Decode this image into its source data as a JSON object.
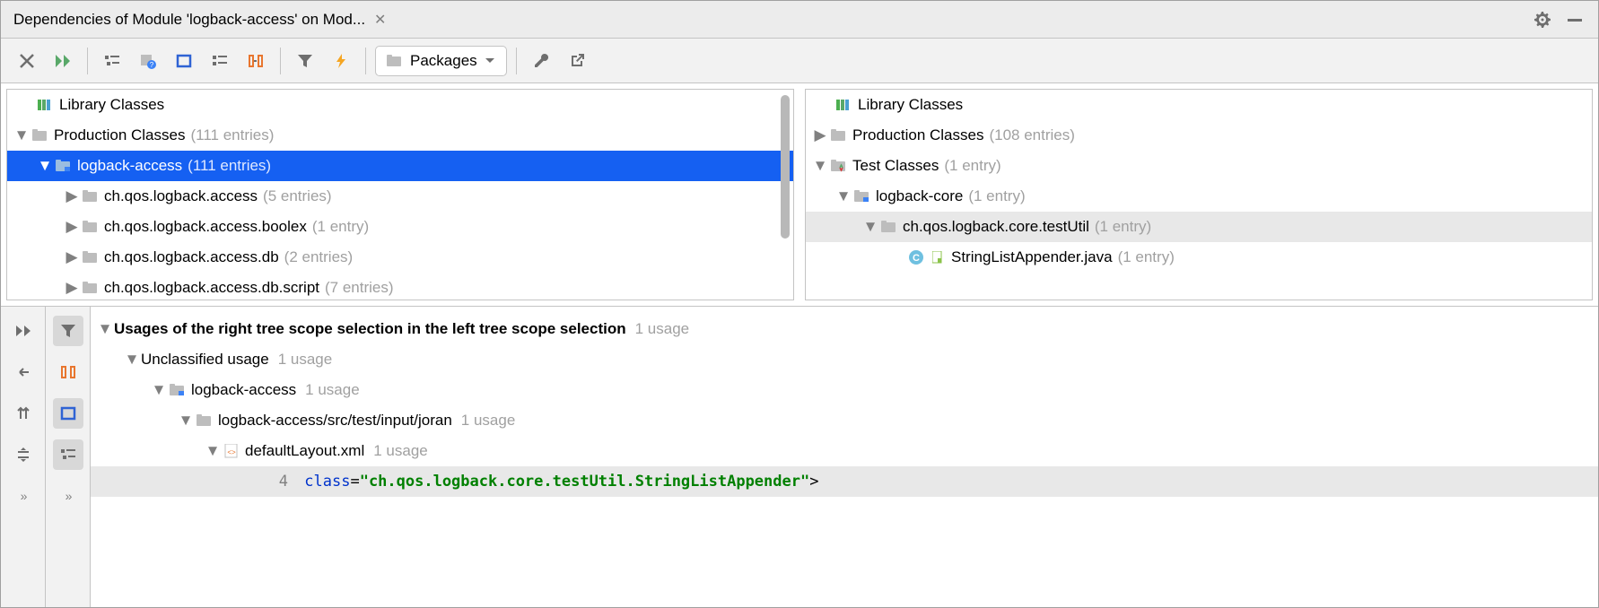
{
  "tab": {
    "title": "Dependencies of Module 'logback-access' on Mod..."
  },
  "toolbar": {
    "packages_label": "Packages"
  },
  "left_tree": {
    "library_label": "Library Classes",
    "prod_label": "Production Classes",
    "prod_count": "(111 entries)",
    "module_label": "logback-access",
    "module_count": "(111 entries)",
    "packages": [
      {
        "name": "ch.qos.logback.access",
        "count": "(5 entries)"
      },
      {
        "name": "ch.qos.logback.access.boolex",
        "count": "(1 entry)"
      },
      {
        "name": "ch.qos.logback.access.db",
        "count": "(2 entries)"
      },
      {
        "name": "ch.qos.logback.access.db.script",
        "count": "(7 entries)"
      }
    ]
  },
  "right_tree": {
    "library_label": "Library Classes",
    "prod_label": "Production Classes",
    "prod_count": "(108 entries)",
    "test_label": "Test Classes",
    "test_count": "(1 entry)",
    "module_label": "logback-core",
    "module_count": "(1 entry)",
    "package_label": "ch.qos.logback.core.testUtil",
    "package_count": "(1 entry)",
    "file_label": "StringListAppender.java",
    "file_count": "(1 entry)"
  },
  "usages": {
    "header": "Usages of the right tree scope selection in the left tree scope selection",
    "header_count": "1 usage",
    "unclassified_label": "Unclassified usage",
    "unclassified_count": "1 usage",
    "module_label": "logback-access",
    "module_count": "1 usage",
    "path_label": "logback-access/src/test/input/joran",
    "path_count": "1 usage",
    "file_label": "defaultLayout.xml",
    "file_count": "1 usage",
    "code": {
      "line_no": "4",
      "attr": "class",
      "eq": "=",
      "q1": "\"",
      "value": "ch.qos.logback.core.testUtil.StringListAppender",
      "q2": "\"",
      "tail": ">"
    }
  }
}
